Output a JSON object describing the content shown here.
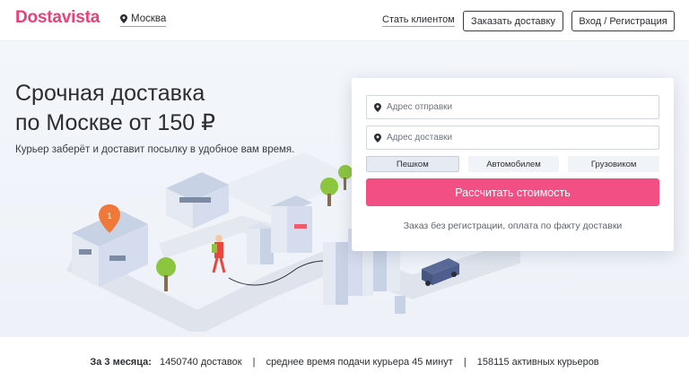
{
  "header": {
    "logo": "Dostavista",
    "city": "Москва",
    "client_link": "Стать клиентом",
    "order_button": "Заказать доставку",
    "login_button": "Вход / Регистрация"
  },
  "hero": {
    "title_line1": "Срочная доставка",
    "title_line2": "по Москве от 150 ₽",
    "subtitle": "Курьер заберёт и доставит посылку в удобное вам время.",
    "marker_number": "1"
  },
  "form": {
    "from_placeholder": "Адрес отправки",
    "to_placeholder": "Адрес доставки",
    "tabs": [
      {
        "label": "Пешком",
        "active": true
      },
      {
        "label": "Автомобилем",
        "active": false
      },
      {
        "label": "Грузовиком",
        "active": false
      }
    ],
    "calc_button": "Рассчитать стоимость",
    "note": "Заказ без регистрации, оплата по факту доставки"
  },
  "stats": {
    "period": "За 3 месяца:",
    "deliveries": "1450740 доставок",
    "avg_time": "среднее время подачи курьера 45 минут",
    "couriers": "158115 активных курьеров",
    "separator": "|"
  },
  "colors": {
    "brand": "#ef3d78",
    "button": "#f24f84",
    "hero_bg": "#f3f6fb"
  }
}
